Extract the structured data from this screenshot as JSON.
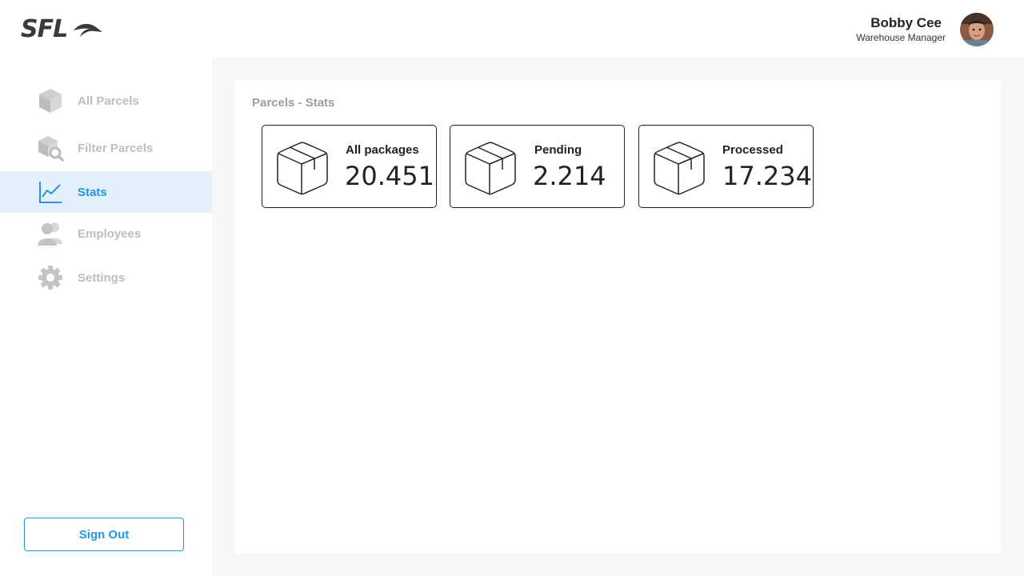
{
  "brand": {
    "logo_text": "SFL"
  },
  "user": {
    "name": "Bobby Cee",
    "role": "Warehouse Manager"
  },
  "sidebar": {
    "items": [
      {
        "label": "All Parcels",
        "icon": "cube-icon",
        "active": false
      },
      {
        "label": "Filter Parcels",
        "icon": "cube-search-icon",
        "active": false
      },
      {
        "label": "Stats",
        "icon": "line-chart-icon",
        "active": true
      },
      {
        "label": "Employees",
        "icon": "users-icon",
        "active": false
      },
      {
        "label": "Settings",
        "icon": "gear-icon",
        "active": false
      }
    ],
    "signout_label": "Sign Out"
  },
  "main": {
    "title": "Parcels - Stats",
    "cards": [
      {
        "label": "All packages",
        "value": "20.451",
        "icon": "package-icon"
      },
      {
        "label": "Pending",
        "value": "2.214",
        "icon": "package-icon"
      },
      {
        "label": "Processed",
        "value": "17.234",
        "icon": "package-icon"
      }
    ]
  },
  "colors": {
    "accent": "#2196e3",
    "active_bg": "#e3f0fb",
    "muted_text": "#bdbdbd",
    "content_bg": "#f7f7f7"
  }
}
